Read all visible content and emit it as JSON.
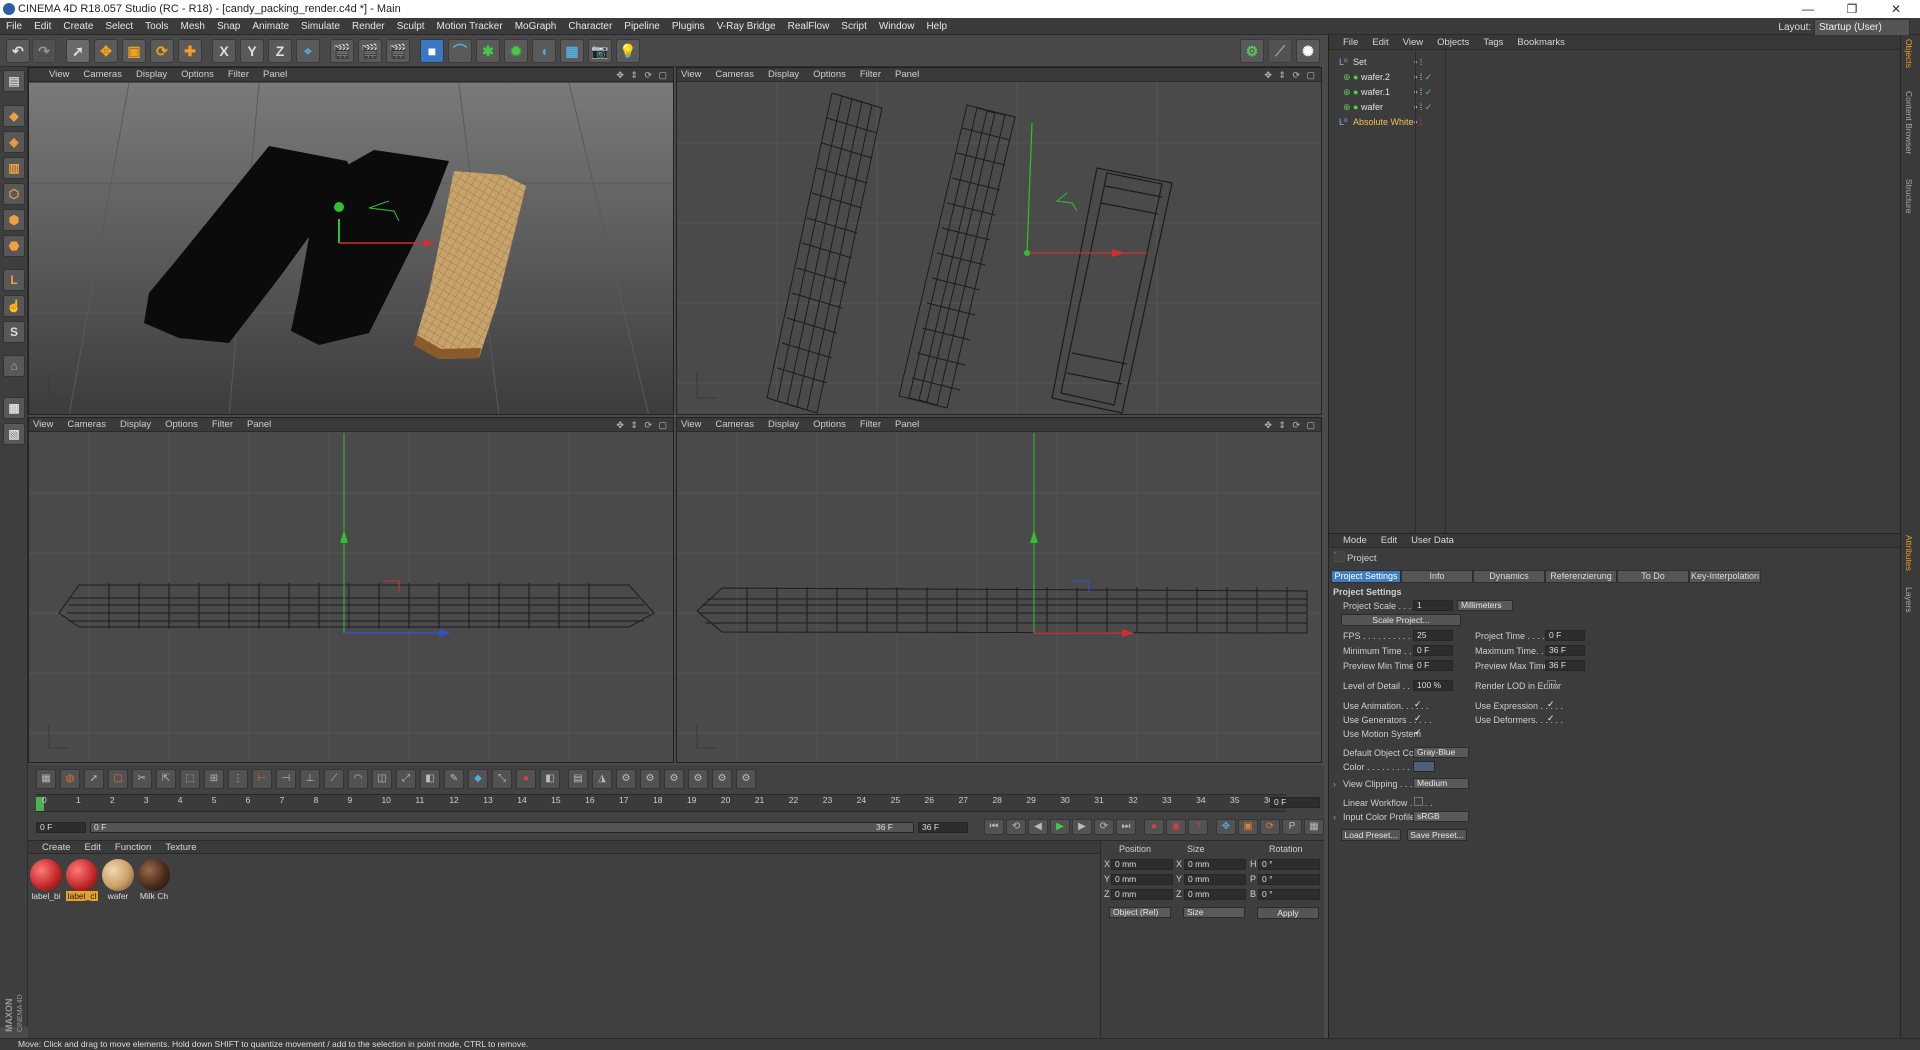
{
  "window": {
    "title": "CINEMA 4D R18.057 Studio (RC - R18) - [candy_packing_render.c4d *] - Main",
    "controls": [
      "—",
      "❐",
      "✕"
    ]
  },
  "menubar": {
    "items": [
      "File",
      "Edit",
      "Create",
      "Select",
      "Tools",
      "Mesh",
      "Snap",
      "Animate",
      "Simulate",
      "Render",
      "Sculpt",
      "Motion Tracker",
      "MoGraph",
      "Character",
      "Pipeline",
      "Plugins",
      "V-Ray Bridge",
      "RealFlow",
      "Script",
      "Window",
      "Help"
    ],
    "layout_label": "Layout:",
    "layout_value": "Startup (User)"
  },
  "toolbar": {
    "axis_labels": [
      "X",
      "Y",
      "Z"
    ]
  },
  "viewports": [
    {
      "menu": [
        "View",
        "Cameras",
        "Display",
        "Options",
        "Filter",
        "Panel"
      ],
      "controls": "✥ ⇕ ⟳ ▢"
    },
    {
      "menu": [
        "View",
        "Cameras",
        "Display",
        "Options",
        "Filter",
        "Panel"
      ],
      "controls": "✥ ⇕ ⟳ ▢"
    },
    {
      "menu": [
        "View",
        "Cameras",
        "Display",
        "Options",
        "Filter",
        "Panel"
      ],
      "controls": "✥ ⇕ ⟳ ▢"
    },
    {
      "menu": [
        "View",
        "Cameras",
        "Display",
        "Options",
        "Filter",
        "Panel"
      ],
      "controls": "✥ ⇕ ⟳ ▢"
    }
  ],
  "object_manager": {
    "menu": [
      "File",
      "Edit",
      "View",
      "Objects",
      "Tags",
      "Bookmarks"
    ],
    "objects": [
      {
        "name": "Set",
        "color": "#e0e0e0"
      },
      {
        "name": "wafer.2",
        "color": "#e0e0e0"
      },
      {
        "name": "wafer.1",
        "color": "#e0e0e0"
      },
      {
        "name": "wafer",
        "color": "#e0e0e0"
      },
      {
        "name": "Absolute White",
        "color": "#f2c14e"
      }
    ]
  },
  "right_tabs": [
    "Objects",
    "Content Browser",
    "Structure",
    "Attributes",
    "Layers"
  ],
  "attributes": {
    "menu": [
      "Mode",
      "Edit",
      "User Data"
    ],
    "object_name": "Project",
    "tabs": [
      "Project Settings",
      "Info",
      "Dynamics",
      "Referenzierung",
      "To Do",
      "Key-Interpolation"
    ],
    "section_title": "Project Settings",
    "project_scale_label": "Project Scale . . . . .",
    "project_scale_value": "1",
    "project_scale_unit": "Millimeters",
    "scale_project_button": "Scale Project...",
    "fps_label": "FPS . . . . . . . . . . . . .",
    "fps_value": "25",
    "project_time_label": "Project Time . . . . . . .",
    "project_time_value": "0 F",
    "min_time_label": "Minimum Time . . . . . .",
    "min_time_value": "0 F",
    "max_time_label": "Maximum Time. . . . . .",
    "max_time_value": "36 F",
    "preview_min_label": "Preview Min Time . . .",
    "preview_min_value": "0 F",
    "preview_max_label": "Preview Max Time . . .",
    "preview_max_value": "36 F",
    "lod_label": "Level of Detail . . . . .",
    "lod_value": "100 %",
    "render_lod_label": "Render LOD in Editor",
    "use_animation_label": "Use Animation. . . . . .",
    "use_expression_label": "Use Expression . . . . .",
    "use_generators_label": "Use Generators . . . . .",
    "use_deformers_label": "Use Deformers. . . . . .",
    "use_motion_label": "Use Motion System",
    "default_color_label": "Default Object Color",
    "default_color_value": "Gray-Blue",
    "color_label": "Color . . . . . . . . . . .",
    "view_clipping_label": "View Clipping . . . . . .",
    "view_clipping_value": "Medium",
    "linear_workflow_label": "Linear Workflow . . . . .",
    "input_profile_label": "Input Color Profile . . .",
    "input_profile_value": "sRGB",
    "load_preset": "Load Preset...",
    "save_preset": "Save Preset...",
    "check_mark": "✓"
  },
  "timeline": {
    "ticks": [
      "0",
      "1",
      "2",
      "3",
      "4",
      "5",
      "6",
      "7",
      "8",
      "9",
      "10",
      "11",
      "12",
      "13",
      "14",
      "15",
      "16",
      "17",
      "18",
      "19",
      "20",
      "21",
      "22",
      "23",
      "24",
      "25",
      "26",
      "27",
      "28",
      "29",
      "30",
      "31",
      "32",
      "33",
      "34",
      "35",
      "36"
    ],
    "current_frame": "0 F",
    "start_field": "0 F",
    "end_field": "36 F",
    "range_start": "0 F",
    "range_end": "36 F"
  },
  "materials": {
    "menu": [
      "Create",
      "Edit",
      "Function",
      "Texture"
    ],
    "items": [
      {
        "label": "label_bi",
        "color": "#c42a2a"
      },
      {
        "label": "label_cl",
        "color": "#c42a2a",
        "selected": true
      },
      {
        "label": "wafer",
        "color": "#c8a06a"
      },
      {
        "label": "Milk Ch",
        "color": "#4a2b1c"
      }
    ]
  },
  "coordinates": {
    "headers": [
      "Position",
      "Size",
      "Rotation"
    ],
    "rows": [
      {
        "axis": "X",
        "pos": "0 mm",
        "size_axis": "X",
        "size": "0 mm",
        "rot_axis": "H",
        "rot": "0 °"
      },
      {
        "axis": "Y",
        "pos": "0 mm",
        "size_axis": "Y",
        "size": "0 mm",
        "rot_axis": "P",
        "rot": "0 °"
      },
      {
        "axis": "Z",
        "pos": "0 mm",
        "size_axis": "Z",
        "size": "0 mm",
        "rot_axis": "B",
        "rot": "0 °"
      }
    ],
    "mode_value": "Object (Rel)",
    "size_mode_value": "Size",
    "apply_button": "Apply"
  },
  "status": "Move: Click and drag to move elements. Hold down SHIFT to quantize movement / add to the selection in point mode, CTRL to remove.",
  "brand": "MAXON CINEMA 4D",
  "colors": {
    "accent": "#3f7cbf",
    "wrapper": "#0b0b0b",
    "wafer": "#c4a16b",
    "axis_x": "#d03030",
    "axis_y": "#30c030",
    "axis_z": "#3050d0"
  }
}
